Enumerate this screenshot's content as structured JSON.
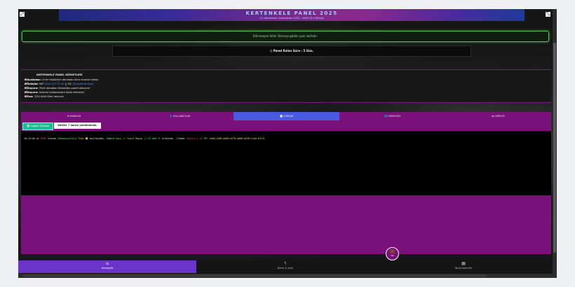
{
  "banner": {
    "title": "KERTENKELE PANEL 2025",
    "subtitle": "(C) Kertenkele Corporation 2025 - 2026 v3.1 Deluxe"
  },
  "notice": {
    "text": "Bilinmeyen Sıfat: Direnye göden yeni sorfadır."
  },
  "panel_time": {
    "icon": "clock",
    "text": "Panel Kalan Süre : 5 Gün."
  },
  "services": {
    "title": "KERTENKELE PANEL HİZMETLERİ",
    "lines": [
      {
        "label": "Açıklama:",
        "text": " Limit müşteriye atmadan önce kontrol ediniz."
      },
      {
        "label": "İletişim:",
        "text": " WP ",
        "link": "0552 627 97 50",
        "text2": " || TG: ",
        "link2": "@phpKertenkele"
      },
      {
        "label": "Duyuru:",
        "text": " Teyit atmadan Kimseden panel almayın!"
      },
      {
        "label": "Duyuru:",
        "text": " İsminizi kullananlara itibar etmeyin!"
      },
      {
        "label": "Son:",
        "text": " 7/24 Aktif Olan mevcut."
      }
    ]
  },
  "tabs": [
    {
      "icon": "gear",
      "label": "AYARLAR",
      "active": false
    },
    {
      "icon": "user",
      "label": "KULLANICILAR",
      "active": false
    },
    {
      "icon": "file",
      "label": "LOGLAR",
      "active": true
    },
    {
      "icon": "globe",
      "label": "HEDEFLER",
      "active": false
    },
    {
      "icon": "doc",
      "label": "VERİLER",
      "active": false
    }
  ],
  "toolbar": {
    "clear_label": "Logları Temizle",
    "refresh_label": "Veriler 7 sonra yenilenecek."
  },
  "log": {
    "time": "18:15:00",
    "ip_prefix": "at",
    "page": "PAGE",
    "action": "Scanda",
    "tag": "[Kodsonuçları]",
    "item": "İlan",
    "user": "key7secede,",
    "name": "Samara Kosy",
    "sep": "//",
    "contact": "Yusuf Ragıp",
    "amount": "// 57.000 TL",
    "result": "ürününde.",
    "status_label": "(Yükme:",
    "status": "Başarılı",
    "ip_label": "// IP:",
    "ip": "2a00:1000:a000:d270:a668:b539:ccb4:67c3)"
  },
  "fab": {
    "icon": "briefcase",
    "label": "Sat"
  },
  "bottom_nav": [
    {
      "icon": "home",
      "label": "Anasayfa",
      "active": true
    },
    {
      "icon": "bolt",
      "label": "İşlem & Ayar",
      "active": false
    },
    {
      "icon": "calc",
      "label": "Toplu İşlemler",
      "active": false
    }
  ],
  "colors": {
    "accent": "#7a117a",
    "tab_active": "#4a5ae0",
    "nav_active": "#6a35c8",
    "notice_border": "#4fbf4f"
  }
}
